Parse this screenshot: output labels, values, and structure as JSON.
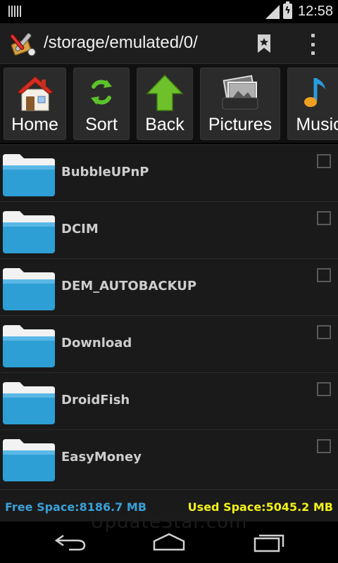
{
  "status_bar": {
    "time": "12:58",
    "icons": [
      "notification-icon",
      "signal-icon",
      "battery-charging-icon"
    ]
  },
  "action_bar": {
    "path": "/storage/emulated/0/",
    "icons": [
      "app-logo-icon",
      "bookmark-icon",
      "overflow-menu-icon"
    ]
  },
  "quick_bar": {
    "buttons": [
      {
        "label": "Home",
        "icon": "house-icon"
      },
      {
        "label": "Sort",
        "icon": "sort-arrows-icon"
      },
      {
        "label": "Back",
        "icon": "up-arrow-icon"
      },
      {
        "label": "Pictures",
        "icon": "pictures-icon"
      },
      {
        "label": "Music",
        "icon": "music-note-icon"
      }
    ]
  },
  "files": [
    {
      "name": "BubbleUPnP",
      "type": "folder",
      "checked": false
    },
    {
      "name": "DCIM",
      "type": "folder",
      "checked": false
    },
    {
      "name": "DEM_AUTOBACKUP",
      "type": "folder",
      "checked": false
    },
    {
      "name": "Download",
      "type": "folder",
      "checked": false
    },
    {
      "name": "DroidFish",
      "type": "folder",
      "checked": false
    },
    {
      "name": "EasyMoney",
      "type": "folder",
      "checked": false
    }
  ],
  "footer": {
    "free_space": "Free Space:8186.7 MB",
    "used_space": "Used Space:5045.2 MB",
    "colors": {
      "free": "#3aa0d8",
      "used": "#f2f21a"
    }
  },
  "nav_bar": {
    "watermark": "UpdateStar.com",
    "buttons": [
      "back-nav-icon",
      "home-nav-icon",
      "recent-apps-icon"
    ]
  }
}
